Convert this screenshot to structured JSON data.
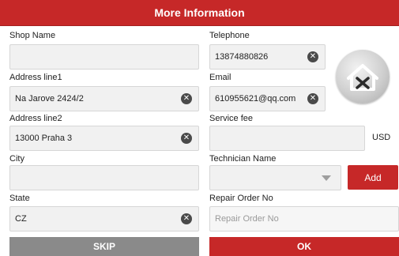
{
  "header": {
    "title": "More Information"
  },
  "left": {
    "shop_name": {
      "label": "Shop Name",
      "value": ""
    },
    "address1": {
      "label": "Address line1",
      "value": "Na Jarove 2424/2"
    },
    "address2": {
      "label": "Address line2",
      "value": "13000 Praha 3"
    },
    "city": {
      "label": "City",
      "value": ""
    },
    "state": {
      "label": "State",
      "value": "CZ"
    }
  },
  "right": {
    "telephone": {
      "label": "Telephone",
      "value": "13874880826"
    },
    "email": {
      "label": "Email",
      "value": "610955621@qq.com"
    },
    "service_fee": {
      "label": "Service fee",
      "value": "",
      "unit": "USD"
    },
    "technician": {
      "label": "Technician Name",
      "value": "",
      "add_label": "Add"
    },
    "repair_order": {
      "label": "Repair Order No",
      "placeholder": "Repair Order No"
    }
  },
  "buttons": {
    "skip": "SKIP",
    "ok": "OK"
  },
  "icons": {
    "clear": "clear-icon",
    "logo": "home-repair-icon",
    "dropdown": "chevron-down-icon"
  },
  "colors": {
    "accent": "#c62828",
    "skip": "#8a8a8a"
  }
}
